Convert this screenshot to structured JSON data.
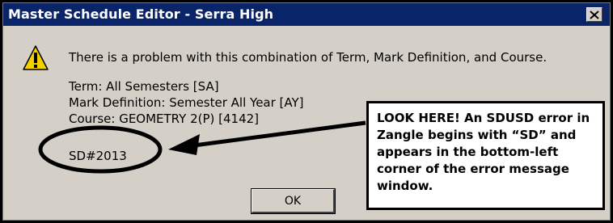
{
  "window": {
    "title": "Master Schedule Editor - Serra High",
    "close_glyph": "✕"
  },
  "message": {
    "intro": "There is a problem with this combination of Term, Mark Definition, and Course.",
    "term": "Term: All Semesters [SA]",
    "mark_definition": "Mark Definition: Semester All Year [AY]",
    "course": "Course: GEOMETRY 2(P) [4142]",
    "error_code": "SD#2013"
  },
  "buttons": {
    "ok_label": "OK"
  },
  "annotation": {
    "callout_text": "LOOK HERE! An SDUSD error in Zangle begins with “SD” and appears in the bottom-left corner of the error message window."
  },
  "icons": {
    "warning": "warning-icon",
    "close": "close-icon"
  },
  "colors": {
    "titlebar": "#0a246a",
    "dialog_bg": "#d4d0c8",
    "warning_yellow": "#f5d000"
  }
}
